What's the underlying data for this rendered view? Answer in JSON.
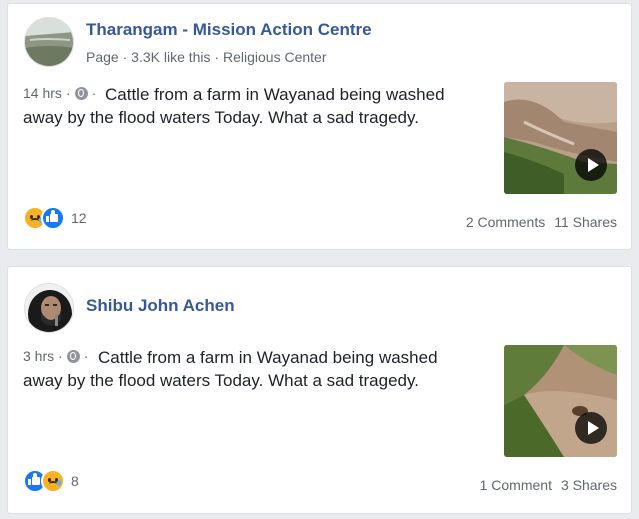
{
  "posts": [
    {
      "author": "Tharangam - Mission Action Centre",
      "meta": {
        "type": "Page",
        "likes": "3.3K like this",
        "category": "Religious Center"
      },
      "time": "14 hrs",
      "text": "Cattle from a farm in Wayanad being washed away by the flood waters Today. What a sad tragedy.",
      "reactions": [
        "sad-icon",
        "like-icon"
      ],
      "reaction_count": "12",
      "comments": "2 Comments",
      "shares": "11 Shares"
    },
    {
      "author": "Shibu John Achen",
      "time": "3 hrs",
      "text": "Cattle from a farm in Wayanad being washed away by the flood waters Today. What a sad tragedy.",
      "reactions": [
        "like-icon",
        "sad-icon"
      ],
      "reaction_count": "8",
      "comments": "1 Comment",
      "shares": "3 Shares"
    }
  ],
  "separator": "·",
  "colors": {
    "link": "#365899",
    "meta": "#606770",
    "background": "#e9ebee"
  }
}
